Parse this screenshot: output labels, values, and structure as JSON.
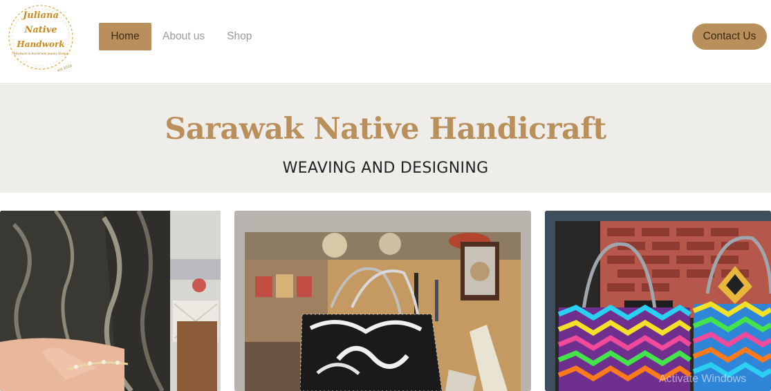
{
  "brand": {
    "logo_lines": [
      "Juliana",
      "Native",
      "Handwork"
    ],
    "logo_tagline": "Beadwork & Handmade Jewelry Design",
    "logo_est": "est 2010",
    "accent_color": "#b98f5b"
  },
  "nav": {
    "items": [
      {
        "label": "Home",
        "active": true
      },
      {
        "label": "About us",
        "active": false
      },
      {
        "label": "Shop",
        "active": false
      }
    ],
    "contact_label": "Contact Us"
  },
  "hero": {
    "title": "Sarawak Native Handicraft",
    "subtitle": "WEAVING AND DESIGNING",
    "background": "#efedea"
  },
  "gallery": {
    "items": [
      {
        "name": "bracelet-photo"
      },
      {
        "name": "woven-basket-shop-photo"
      },
      {
        "name": "colorful-baskets-photo"
      }
    ]
  },
  "overlay": {
    "watermark": "Activate Windows"
  }
}
